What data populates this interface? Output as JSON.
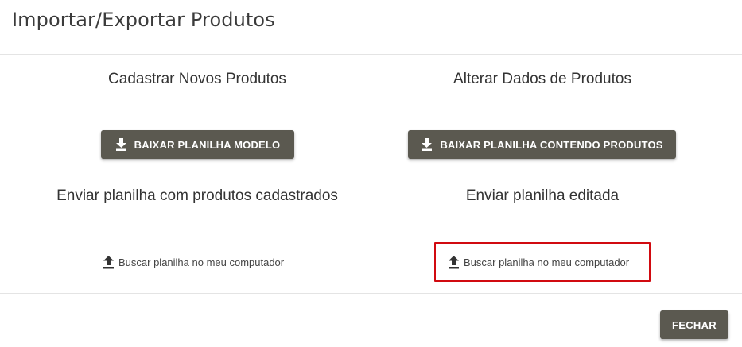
{
  "dialog": {
    "title": "Importar/Exportar Produtos",
    "close_label": "FECHAR"
  },
  "left": {
    "heading": "Cadastrar Novos Produtos",
    "download_label": "BAIXAR PLANILHA MODELO",
    "upload_heading": "Enviar planilha com produtos cadastrados",
    "upload_label": "Buscar planilha no meu computador"
  },
  "right": {
    "heading": "Alterar Dados de Produtos",
    "download_label": "BAIXAR PLANILHA CONTENDO PRODUTOS",
    "upload_heading": "Enviar planilha editada",
    "upload_label": "Buscar planilha no meu computador"
  },
  "icons": {
    "download": "download-icon",
    "upload": "upload-icon"
  },
  "colors": {
    "button_bg": "#5b5950",
    "button_text": "#ffffff",
    "highlight_border": "#d10a10",
    "divider": "#e4e4e4"
  }
}
